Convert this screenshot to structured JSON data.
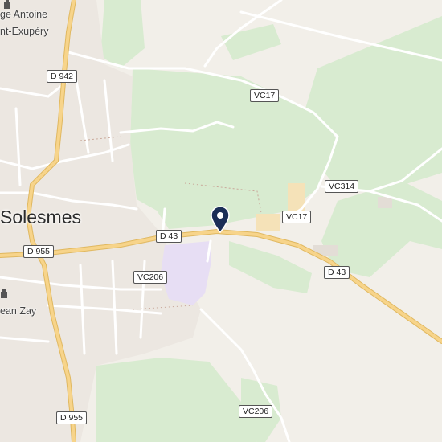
{
  "map": {
    "place_labels": {
      "town": "Solesmes",
      "college_line1": "ge Antoine",
      "college_line2": "nt-Exupéry",
      "school": "ean Zay"
    },
    "road_labels": {
      "d942": "D 942",
      "vc17_north": "VC17",
      "vc314": "VC314",
      "vc17_east": "VC17",
      "d43_west": "D 43",
      "d43_east": "D 43",
      "d955_west": "D 955",
      "vc206_west": "VC206",
      "vc206_south": "VC206",
      "d955_south": "D 955"
    },
    "marker": {
      "icon": "location-pin-icon",
      "color": "#1b2e57"
    },
    "colors": {
      "background": "#f2efe9",
      "forest": "#d8ebd0",
      "major_road": "#f7d48a",
      "minor_road": "#ffffff",
      "school_area": "#e7def4"
    }
  }
}
